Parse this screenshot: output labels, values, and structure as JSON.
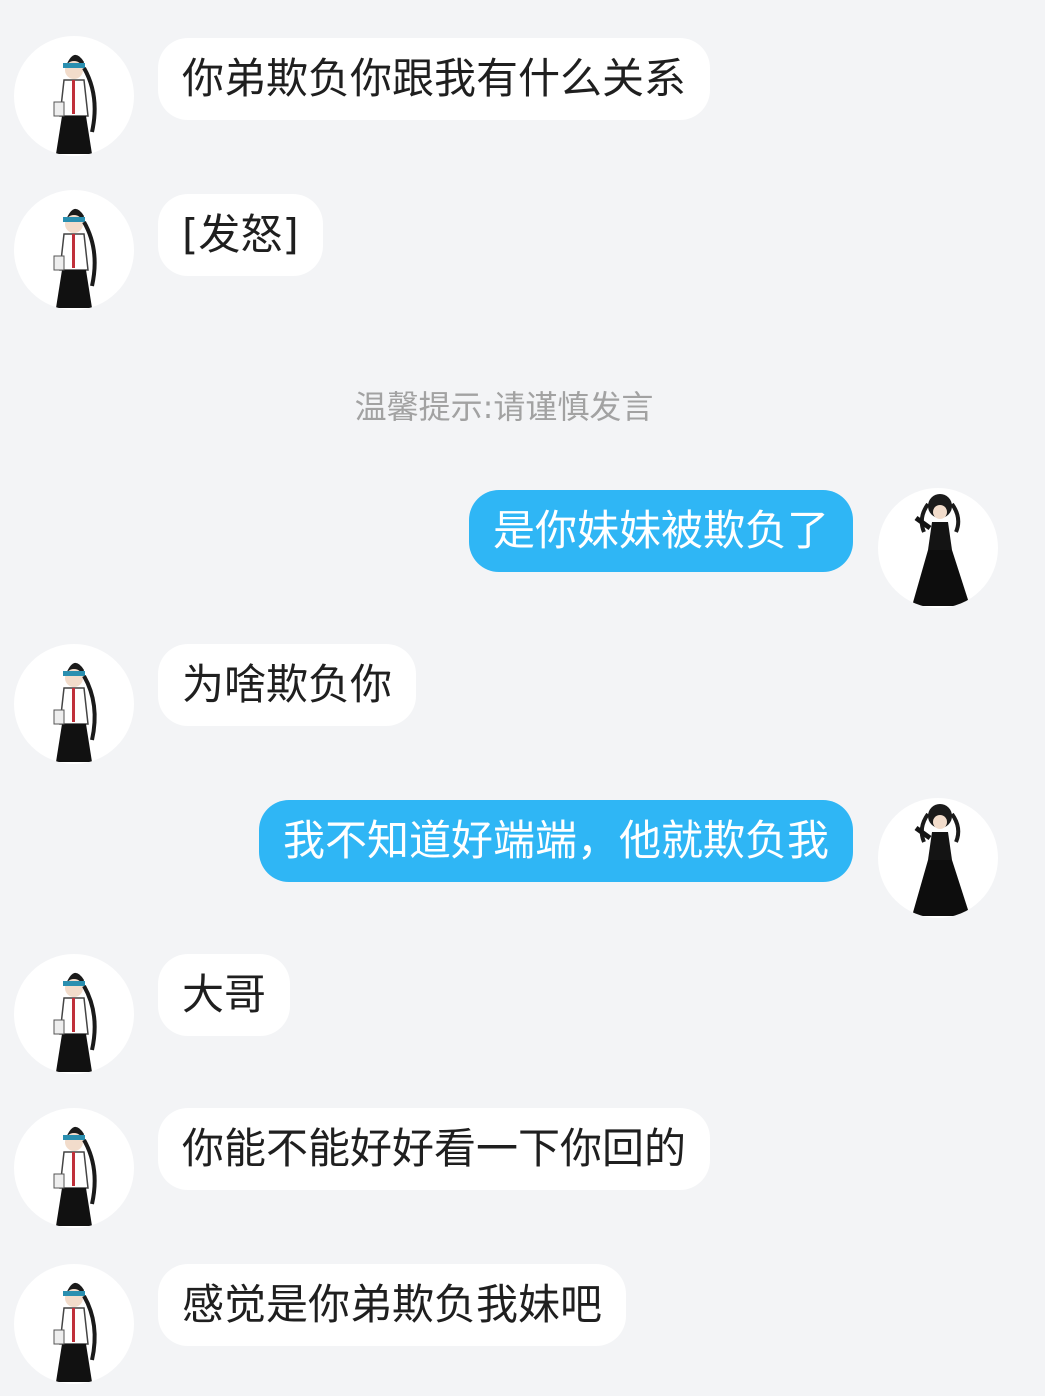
{
  "notice": "温馨提示:请谨慎发言",
  "messages": [
    {
      "side": "in",
      "avatar": "other-user-avatar",
      "text": "你弟欺负你跟我有什么关系"
    },
    {
      "side": "in",
      "avatar": "other-user-avatar",
      "text": "[发怒]"
    },
    {
      "side": "out",
      "avatar": "self-user-avatar",
      "text": "是你妹妹被欺负了"
    },
    {
      "side": "in",
      "avatar": "other-user-avatar",
      "text": "为啥欺负你"
    },
    {
      "side": "out",
      "avatar": "self-user-avatar",
      "text": "我不知道好端端，他就欺负我"
    },
    {
      "side": "in",
      "avatar": "other-user-avatar",
      "text": "大哥"
    },
    {
      "side": "in",
      "avatar": "other-user-avatar",
      "text": "你能不能好好看一下你回的"
    },
    {
      "side": "in",
      "avatar": "other-user-avatar",
      "text": "感觉是你弟欺负我妹吧"
    }
  ],
  "colors": {
    "background": "#f3f4f6",
    "incoming_bubble": "#ffffff",
    "outgoing_bubble": "#2fb6f5",
    "notice_text": "#a2a2a2"
  }
}
